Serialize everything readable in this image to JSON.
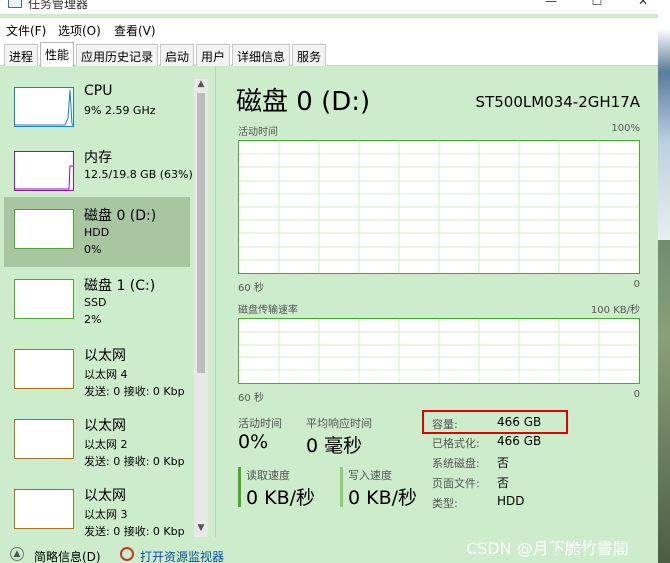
{
  "window": {
    "title": "任务管理器"
  },
  "menu": [
    "文件(F)",
    "选项(O)",
    "查看(V)"
  ],
  "tabs": [
    "进程",
    "性能",
    "应用历史记录",
    "启动",
    "用户",
    "详细信息",
    "服务"
  ],
  "active_tab": "性能",
  "sidebar": [
    {
      "name": "CPU",
      "sub1": "9% 2.59 GHz",
      "sub2": "",
      "color": "#1f7fc8"
    },
    {
      "name": "内存",
      "sub1": "12.5/19.8 GB (63%)",
      "sub2": "",
      "color": "#8b16a8"
    },
    {
      "name": "磁盘 0 (D:)",
      "sub1": "HDD",
      "sub2": "0%",
      "color": "#4ea72e",
      "selected": true
    },
    {
      "name": "磁盘 1 (C:)",
      "sub1": "SSD",
      "sub2": "2%",
      "color": "#4ea72e"
    },
    {
      "name": "以太网",
      "sub1": "以太网 4",
      "sub2": "发送: 0 接收: 0 Kbp",
      "color": "#a86f1e"
    },
    {
      "name": "以太网",
      "sub1": "以太网 2",
      "sub2": "发送: 0 接收: 0 Kbp",
      "color": "#a86f1e"
    },
    {
      "name": "以太网",
      "sub1": "以太网 3",
      "sub2": "发送: 0 接收: 0 Kbp",
      "color": "#a86f1e"
    }
  ],
  "detail": {
    "title": "磁盘 0 (D:)",
    "model": "ST500LM034-2GH17A",
    "graph1": {
      "label": "活动时间",
      "max": "100%",
      "left": "60 秒",
      "right": "0"
    },
    "graph2": {
      "label": "磁盘传输速率",
      "max": "100 KB/秒",
      "left": "60 秒",
      "right": "0"
    },
    "active_time": {
      "label": "活动时间",
      "value": "0%"
    },
    "response": {
      "label": "平均响应时间",
      "value": "0 毫秒"
    },
    "read": {
      "label": "读取速度",
      "value": "0 KB/秒"
    },
    "write": {
      "label": "写入速度",
      "value": "0 KB/秒"
    },
    "props": [
      {
        "key": "容量:",
        "value": "466 GB"
      },
      {
        "key": "已格式化:",
        "value": "466 GB"
      },
      {
        "key": "系统磁盘:",
        "value": "否"
      },
      {
        "key": "页面文件:",
        "value": "否"
      },
      {
        "key": "类型:",
        "value": "HDD"
      }
    ]
  },
  "footer": {
    "summary": "简略信息(D)",
    "resmon": "打开资源监视器"
  },
  "watermark": "CSDN @月下脆竹書閣",
  "colors": {
    "background": "#cdeccc",
    "disk_green": "#4ea72e",
    "highlight": "#e00000"
  }
}
